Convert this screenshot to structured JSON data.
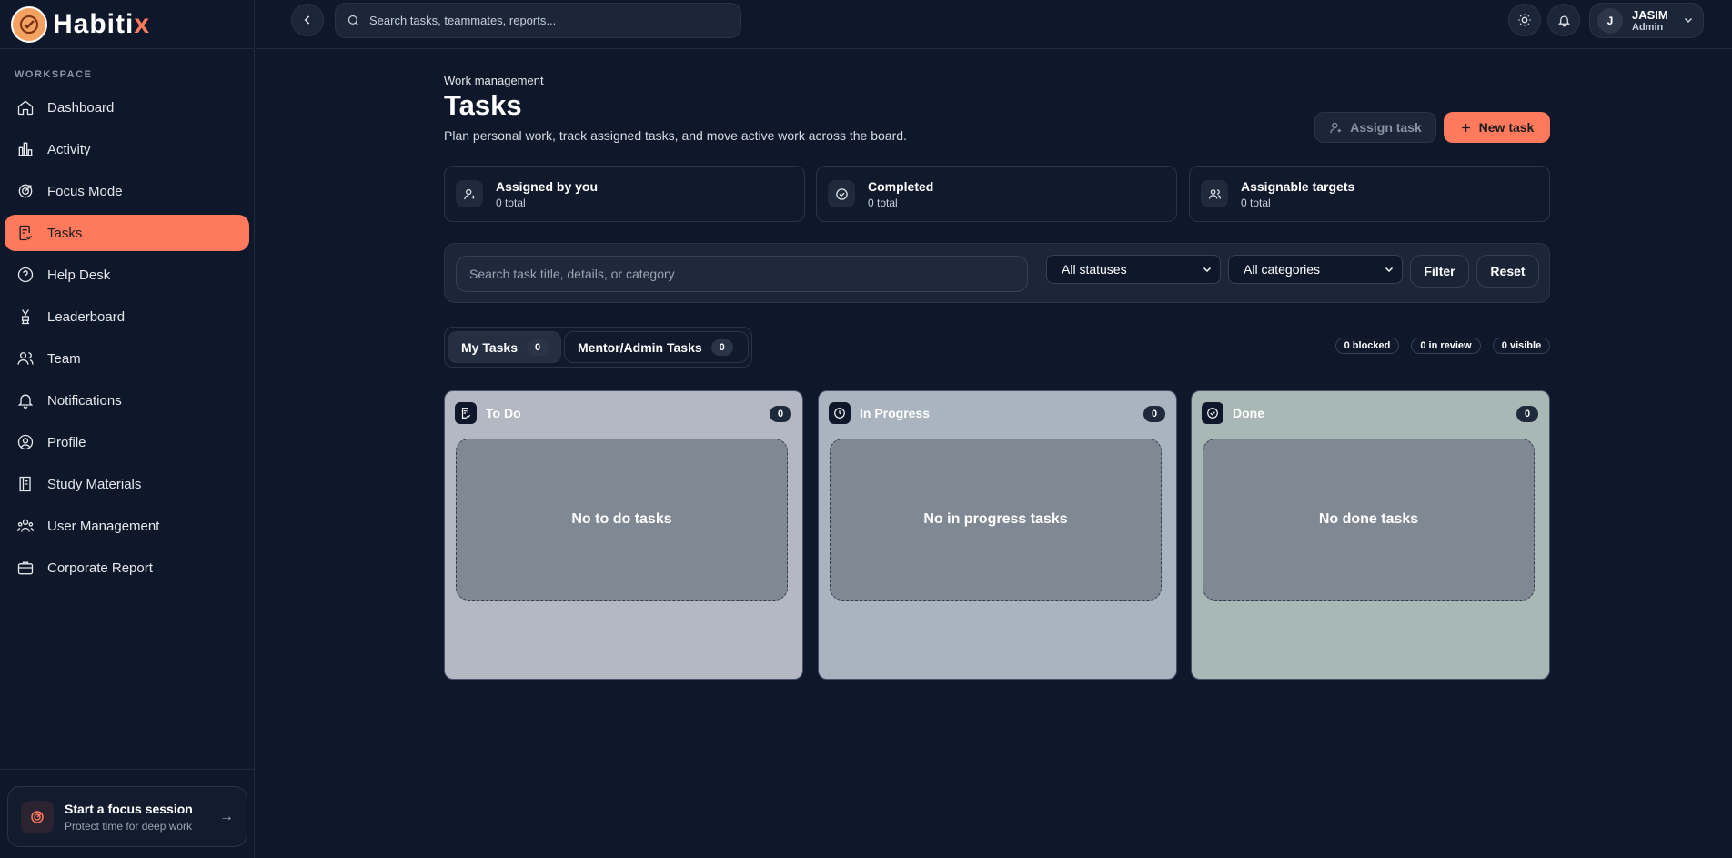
{
  "brand": {
    "name_main": "Habiti",
    "name_accent": "x"
  },
  "sidebar": {
    "section_label": "WORKSPACE",
    "items": [
      {
        "label": "Dashboard",
        "icon": "home-icon"
      },
      {
        "label": "Activity",
        "icon": "bar-chart-icon"
      },
      {
        "label": "Focus Mode",
        "icon": "target-icon"
      },
      {
        "label": "Tasks",
        "icon": "clipboard-check-icon",
        "active": true
      },
      {
        "label": "Help Desk",
        "icon": "help-circle-icon"
      },
      {
        "label": "Leaderboard",
        "icon": "award-icon"
      },
      {
        "label": "Team",
        "icon": "users-icon"
      },
      {
        "label": "Notifications",
        "icon": "bell-icon"
      },
      {
        "label": "Profile",
        "icon": "user-circle-icon"
      },
      {
        "label": "Study Materials",
        "icon": "book-icon"
      },
      {
        "label": "User Management",
        "icon": "user-group-icon"
      },
      {
        "label": "Corporate Report",
        "icon": "briefcase-icon"
      }
    ],
    "focus": {
      "title": "Start a focus session",
      "subtitle": "Protect time for deep work"
    }
  },
  "topbar": {
    "search_placeholder": "Search tasks, teammates, reports...",
    "user": {
      "initial": "J",
      "name": "JASIM",
      "role": "Admin"
    }
  },
  "header": {
    "eyebrow": "Work management",
    "title": "Tasks",
    "subtitle": "Plan personal work, track assigned tasks, and move active work across the board.",
    "assign_label": "Assign task",
    "new_label": "New task"
  },
  "stats": [
    {
      "title": "Assigned by you",
      "value": "0 total"
    },
    {
      "title": "Completed",
      "value": "0 total"
    },
    {
      "title": "Assignable targets",
      "value": "0 total"
    }
  ],
  "filters": {
    "search_placeholder": "Search task title, details, or category",
    "status_selected": "All statuses",
    "category_selected": "All categories",
    "filter_label": "Filter",
    "reset_label": "Reset"
  },
  "tabs": [
    {
      "label": "My Tasks",
      "count": "0",
      "active": true
    },
    {
      "label": "Mentor/Admin Tasks",
      "count": "0",
      "active": false
    }
  ],
  "summary": {
    "blocked": "0 blocked",
    "review": "0 in review",
    "visible": "0 visible"
  },
  "columns": [
    {
      "title": "To Do",
      "count": "0",
      "empty": "No to do tasks",
      "bg": "#b4b8c2"
    },
    {
      "title": "In Progress",
      "count": "0",
      "empty": "No in progress tasks",
      "bg": "#aab4c1"
    },
    {
      "title": "Done",
      "count": "0",
      "empty": "No done tasks",
      "bg": "#a8b9b5"
    }
  ],
  "colors": {
    "accent": "#ff7a5c",
    "background": "#0f172a"
  }
}
